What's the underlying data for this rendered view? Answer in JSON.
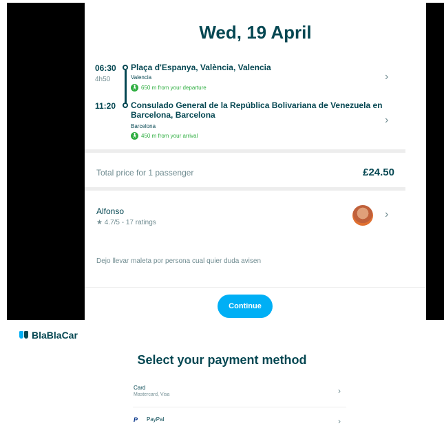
{
  "trip": {
    "date": "Wed, 19 April",
    "departure_time": "06:30",
    "duration": "4h50",
    "departure_place": "Plaça d'Espanya, València, Valencia",
    "departure_city": "Valencia",
    "departure_walk": "650 m from your departure",
    "arrival_time": "11:20",
    "arrival_place_line1": "Consulado General de la República Bolivariana de Venezuela en",
    "arrival_place_line2": "Barcelona, Barcelona",
    "arrival_city": "Barcelona",
    "arrival_walk": "450 m from your arrival"
  },
  "price": {
    "label": "Total price for 1 passenger",
    "value": "£24.50"
  },
  "driver": {
    "name": "Alfonso",
    "rating": "★ 4.7/5 - 17 ratings",
    "message": "Dejo llevar maleta por persona cual quier duda avisen"
  },
  "actions": {
    "continue_label": "Continue"
  },
  "payment": {
    "brand": "BlaBlaCar",
    "title": "Select your payment method",
    "methods": [
      {
        "label": "Card",
        "sub": "Mastercard, Visa"
      },
      {
        "label": "PayPal",
        "sub": ""
      }
    ]
  },
  "icons": {
    "chevron": "chevron-right-icon",
    "walk": "walking-icon",
    "star": "star-icon",
    "paypal": "paypal-icon",
    "logo": "blablacar-logo"
  },
  "colors": {
    "primary_text": "#054752",
    "accent": "#00aff5",
    "walk_green": "#2fae41",
    "muted": "#708c91"
  }
}
